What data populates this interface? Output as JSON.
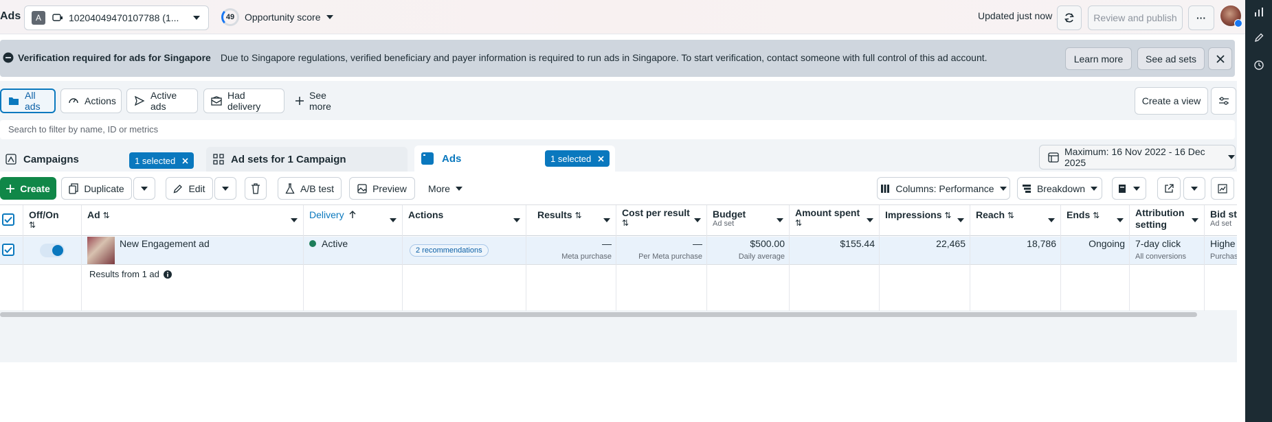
{
  "header": {
    "app_title": "Ads",
    "account_badge": "A",
    "account_id": "10204049470107788 (1...",
    "opportunity_score": "49",
    "opportunity_label": "Opportunity score",
    "updated_text": "Updated just now",
    "review_publish": "Review and publish",
    "more": "···"
  },
  "banner": {
    "title": "Verification required for ads for Singapore",
    "message": "Due to Singapore regulations, verified beneficiary and payer information is required to run ads in Singapore. To start verification, contact someone with full control of this ad account.",
    "learn_more": "Learn more",
    "see_ad_sets": "See ad sets"
  },
  "views": {
    "tabs": [
      "All ads",
      "Actions",
      "Active ads",
      "Had delivery"
    ],
    "see_more": "See more",
    "create_view": "Create a view"
  },
  "search": {
    "placeholder": "Search to filter by name, ID or metrics"
  },
  "levels": {
    "campaigns": "Campaigns",
    "campaigns_selected": "1 selected",
    "ad_sets": "Ad sets for 1 Campaign",
    "ads": "Ads",
    "ads_selected": "1 selected"
  },
  "date_range": "Maximum: 16 Nov 2022 - 16 Dec 2025",
  "toolbar": {
    "create": "Create",
    "duplicate": "Duplicate",
    "edit": "Edit",
    "ab_test": "A/B test",
    "preview": "Preview",
    "more": "More",
    "columns": "Columns: Performance",
    "breakdown": "Breakdown"
  },
  "table": {
    "headers": {
      "off_on": "Off/On",
      "ad": "Ad",
      "delivery": "Delivery",
      "actions": "Actions",
      "results": "Results",
      "cost_per_result": "Cost per result",
      "budget": "Budget",
      "budget_sub": "Ad set",
      "amount_spent": "Amount spent",
      "impressions": "Impressions",
      "reach": "Reach",
      "ends": "Ends",
      "attribution": "Attribution setting",
      "bid_strategy": "Bid stra",
      "bid_sub": "Ad set"
    },
    "sort_glyph": "⇅",
    "row": {
      "ad_name": "New Engagement ad",
      "delivery": "Active",
      "recommendations": "2 recommendations",
      "results": "—",
      "results_sub": "Meta purchase",
      "cost": "—",
      "cost_sub": "Per Meta purchase",
      "budget": "$500.00",
      "budget_sub": "Daily average",
      "amount_spent": "$155.44",
      "impressions": "22,465",
      "reach": "18,786",
      "ends": "Ongoing",
      "attribution": "7-day click",
      "attribution_sub": "All conversions",
      "bid": "Highe",
      "bid_sub": "Purchase"
    },
    "summary": "Results from 1 ad"
  },
  "colors": {
    "accent": "#0a78be",
    "create": "#108748",
    "rail": "#1c2b33"
  }
}
